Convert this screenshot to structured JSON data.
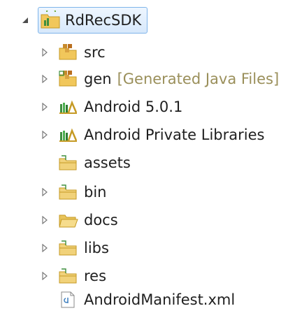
{
  "tree": {
    "root": {
      "label": "RdRecSDK",
      "expanded": true,
      "selected": true,
      "icon": "android-project-icon"
    },
    "children": [
      {
        "label": "src",
        "decoration": "",
        "icon": "source-package-folder-icon",
        "expandable": true
      },
      {
        "label": "gen",
        "decoration": "[Generated Java Files]",
        "icon": "generated-source-folder-icon",
        "expandable": true
      },
      {
        "label": "Android 5.0.1",
        "decoration": "",
        "icon": "library-container-icon",
        "expandable": true
      },
      {
        "label": "Android Private Libraries",
        "decoration": "",
        "icon": "library-container-icon",
        "expandable": true
      },
      {
        "label": "assets",
        "decoration": "",
        "icon": "folder-icon",
        "expandable": false
      },
      {
        "label": "bin",
        "decoration": "",
        "icon": "folder-icon",
        "expandable": true
      },
      {
        "label": "docs",
        "decoration": "",
        "icon": "open-folder-icon",
        "expandable": true
      },
      {
        "label": "libs",
        "decoration": "",
        "icon": "folder-icon",
        "expandable": true
      },
      {
        "label": "res",
        "decoration": "",
        "icon": "folder-icon",
        "expandable": true
      },
      {
        "label": "AndroidManifest.xml",
        "decoration": "",
        "icon": "xml-file-icon",
        "expandable": false
      }
    ]
  },
  "colors": {
    "selection": "#d7e8fb",
    "selection_border": "#7eb4ea",
    "decoration_text": "#9a8f5a",
    "folder_yellow": "#e8c45a",
    "android_green": "#7cb342",
    "library_green": "#3f8f3f"
  }
}
